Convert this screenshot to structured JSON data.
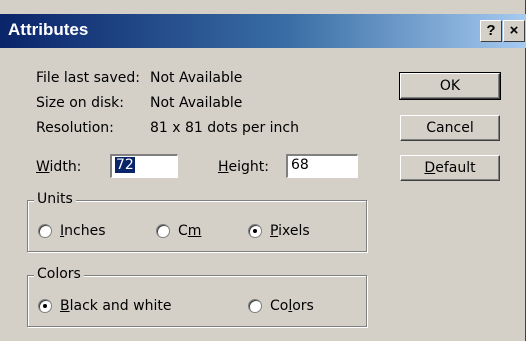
{
  "window": {
    "title": "Attributes",
    "help_label": "?",
    "close_label": "×"
  },
  "info": {
    "last_saved_label": "File last saved:",
    "last_saved_value": "Not Available",
    "size_label": "Size on disk:",
    "size_value": "Not Available",
    "resolution_label": "Resolution:",
    "resolution_value": "81 x 81 dots per inch"
  },
  "dimensions": {
    "width_label_accel": "W",
    "width_label_rest": "idth:",
    "width_value": "72",
    "height_label_accel": "H",
    "height_label_rest": "eight:",
    "height_value": "68"
  },
  "units": {
    "legend": "Units",
    "options": [
      {
        "accel": "I",
        "rest": "nches",
        "selected": false
      },
      {
        "pre": "C",
        "accel": "m",
        "selected": false
      },
      {
        "accel": "P",
        "rest": "ixels",
        "selected": true
      }
    ]
  },
  "colors": {
    "legend": "Colors",
    "options": [
      {
        "accel": "B",
        "rest": "lack and white",
        "selected": true
      },
      {
        "pre": "Co",
        "accel": "l",
        "rest": "ors",
        "selected": false
      }
    ]
  },
  "buttons": {
    "ok": "OK",
    "cancel": "Cancel",
    "default_accel": "D",
    "default_rest": "efault"
  },
  "theme": {
    "titlebar_start": "#0a246a",
    "titlebar_end": "#a6caf0",
    "face": "#d4d0c8",
    "selection": "#0a246a"
  }
}
